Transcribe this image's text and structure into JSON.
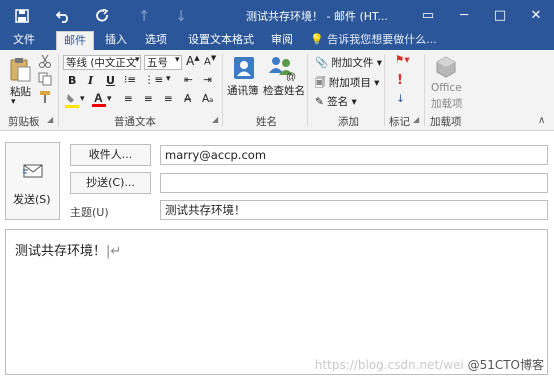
{
  "window": {
    "title": "测试共存环境！ - 邮件 (HT...",
    "quick_access": {
      "save_icon": "save-icon",
      "undo_icon": "undo-icon",
      "redo_icon": "redo-icon",
      "up_icon": "arrow-up-icon",
      "down_icon": "arrow-down-icon"
    },
    "controls": {
      "restore": "▭",
      "minimize": "─",
      "maximize": "□",
      "close": "✕"
    }
  },
  "tabs": [
    {
      "label": "文件"
    },
    {
      "label": "邮件",
      "active": true
    },
    {
      "label": "插入"
    },
    {
      "label": "选项"
    },
    {
      "label": "设置文本格式"
    },
    {
      "label": "审阅"
    }
  ],
  "tell_me": "告诉我您想要做什么...",
  "ribbon": {
    "clipboard": {
      "paste": "粘贴",
      "label": "剪贴板"
    },
    "basic_text": {
      "font": "等线 (中文正文",
      "size": "五号",
      "bold": "B",
      "italic": "I",
      "underline": "U",
      "label": "普通文本"
    },
    "names": {
      "address_book": "通讯簿",
      "check_names": "检查姓名",
      "label": "姓名"
    },
    "include": {
      "attach_file": "附加文件",
      "attach_item": "附加项目",
      "signature": "签名",
      "label": "添加"
    },
    "tags": {
      "label": "标记"
    },
    "addins": {
      "office": "Office",
      "addins_label": "加载项",
      "label": "加载项"
    }
  },
  "compose": {
    "send_label": "发送(S)",
    "to_button": "收件人...",
    "cc_button": "抄送(C)...",
    "subject_label": "主题(U)",
    "to_value": "marry@accp.com",
    "cc_value": "",
    "subject_value": "测试共存环境！",
    "body_text": "测试共存环境！"
  },
  "watermark": {
    "url": "https://blog.csdn.net/wei",
    "brand": "@51CTO博客"
  },
  "colors": {
    "brand_blue": "#2b579a",
    "ribbon_bg": "#f3f3f3"
  }
}
